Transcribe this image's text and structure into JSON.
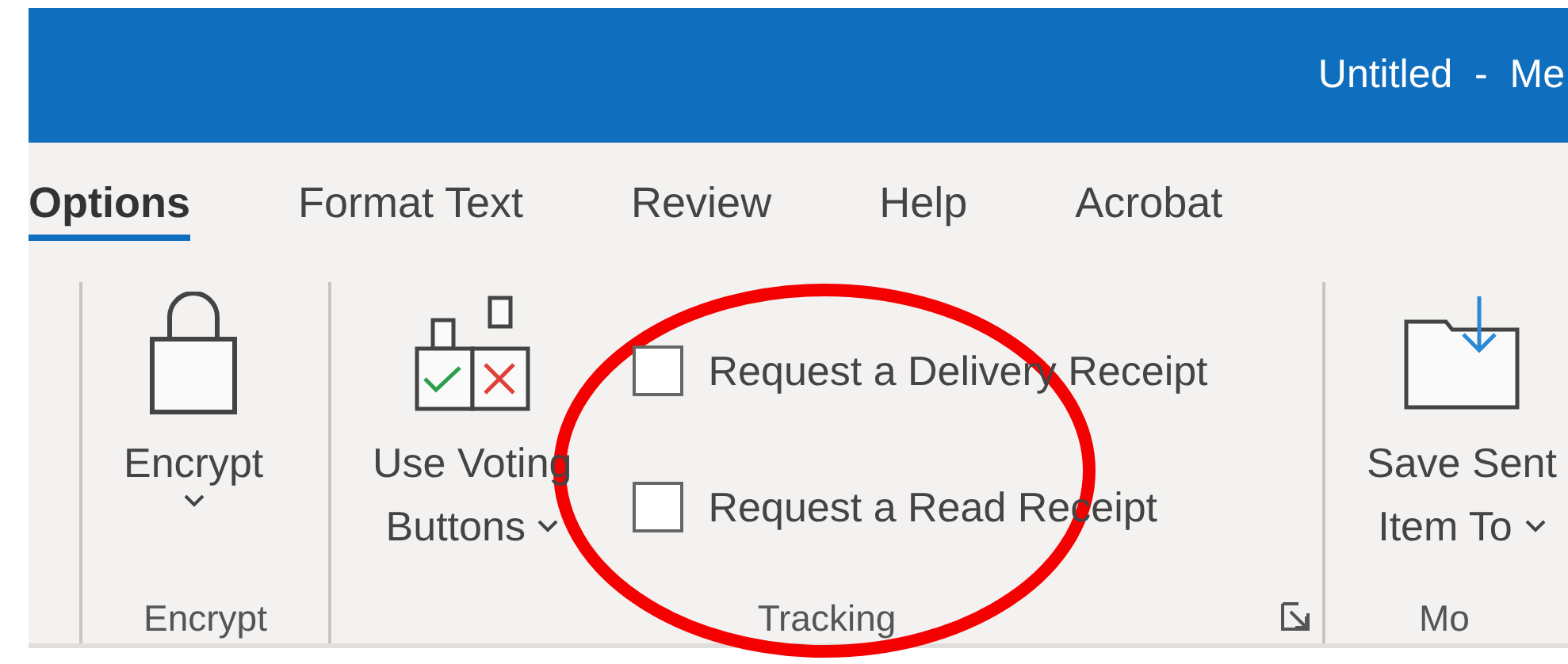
{
  "window": {
    "title": "Untitled  -  Me"
  },
  "tabs": [
    {
      "label": "Options",
      "selected": true
    },
    {
      "label": "Format Text",
      "selected": false
    },
    {
      "label": "Review",
      "selected": false
    },
    {
      "label": "Help",
      "selected": false
    },
    {
      "label": "Acrobat",
      "selected": false
    }
  ],
  "groups": [
    {
      "label": "Encrypt",
      "dialog_launcher": false,
      "commands": [
        {
          "kind": "large",
          "lines": [
            "Encrypt"
          ],
          "dropdown": true
        }
      ]
    },
    {
      "label": "Tracking",
      "dialog_launcher": true,
      "commands": [
        {
          "kind": "large",
          "lines": [
            "Use Voting",
            "Buttons"
          ],
          "dropdown": true
        }
      ],
      "checkboxes": [
        {
          "label": "Request a Delivery Receipt",
          "checked": false
        },
        {
          "label": "Request a Read Receipt",
          "checked": false
        }
      ]
    },
    {
      "label": "Mo",
      "dialog_launcher": false,
      "commands": [
        {
          "kind": "large",
          "lines": [
            "Save Sent",
            "Item To"
          ],
          "dropdown": true
        }
      ]
    }
  ],
  "annotations": [
    {
      "kind": "ellipse"
    }
  ]
}
